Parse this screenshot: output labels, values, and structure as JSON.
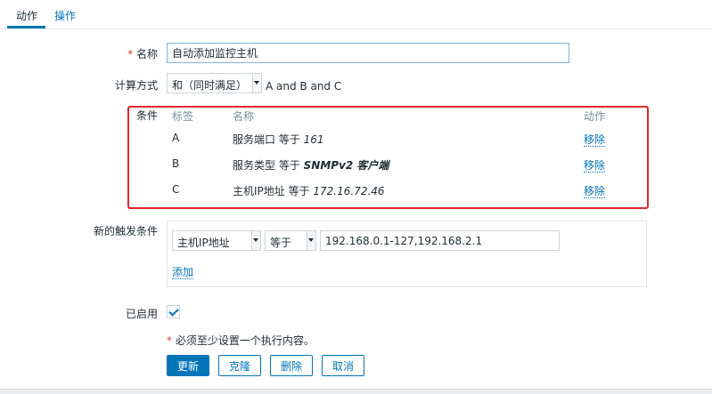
{
  "tabs": [
    {
      "label": "动作"
    },
    {
      "label": "操作"
    }
  ],
  "form": {
    "name": {
      "required_mark": "*",
      "label": "名称",
      "value": "自动添加监控主机"
    },
    "calc": {
      "label": "计算方式",
      "selected": "和（同时满足）",
      "expression": "A and B and C"
    },
    "conditions": {
      "label": "条件",
      "headers": {
        "tag": "标签",
        "name": "名称",
        "action": "动作"
      },
      "rows": [
        {
          "tag": "A",
          "text": "服务端口 等于 ",
          "value": "161",
          "action": "移除"
        },
        {
          "tag": "B",
          "text": "服务类型 等于 ",
          "value": "SNMPv2 客户端",
          "action": "移除"
        },
        {
          "tag": "C",
          "text": "主机IP地址 等于 ",
          "value": "172.16.72.46",
          "action": "移除"
        }
      ]
    },
    "new_condition": {
      "label": "新的触发条件",
      "type_selected": "主机IP地址",
      "operator_selected": "等于",
      "value": "192.168.0.1-127,192.168.2.1",
      "add_label": "添加"
    },
    "enabled": {
      "label": "已启用",
      "checked": true
    },
    "note": {
      "mark": "*",
      "text": "必须至少设置一个执行内容。"
    }
  },
  "buttons": {
    "update": "更新",
    "clone": "克隆",
    "delete": "删除",
    "cancel": "取消"
  },
  "colors": {
    "accent": "#0275b8",
    "highlight_border": "#e0272a",
    "required": "#e33734"
  }
}
